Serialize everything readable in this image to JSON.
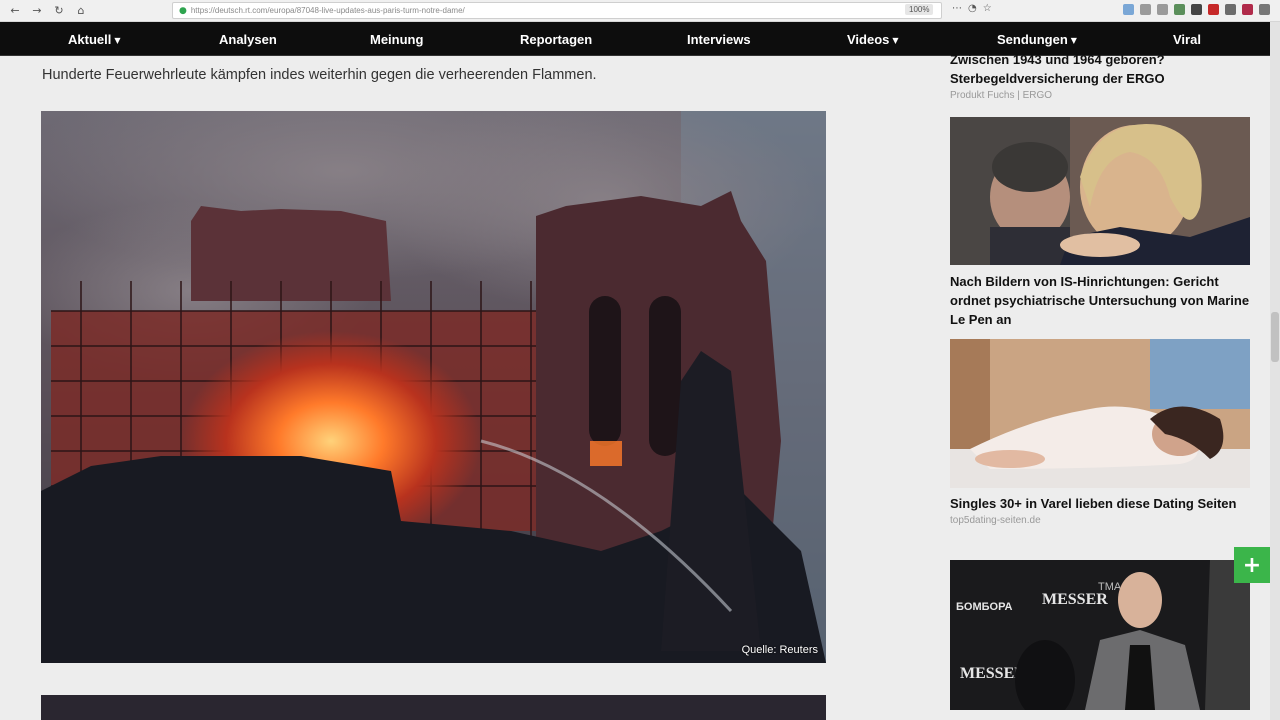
{
  "browser": {
    "url": "https://deutsch.rt.com/europa/87048-live-updates-aus-paris-turm-notre-dame/",
    "zoom": "100%",
    "icons": [
      "back-icon",
      "forward-icon",
      "reload-icon",
      "home-icon",
      "lock-icon",
      "reader-icon",
      "pocket-icon",
      "bookmark-star-icon"
    ]
  },
  "site_nav": {
    "items": [
      {
        "label": "Aktuell",
        "dropdown": true
      },
      {
        "label": "Analysen",
        "dropdown": false
      },
      {
        "label": "Meinung",
        "dropdown": false
      },
      {
        "label": "Reportagen",
        "dropdown": false
      },
      {
        "label": "Interviews",
        "dropdown": false
      },
      {
        "label": "Videos",
        "dropdown": true
      },
      {
        "label": "Sendungen",
        "dropdown": true
      },
      {
        "label": "Viral",
        "dropdown": false
      }
    ]
  },
  "article": {
    "lead": "Hunderte Feuerwehrleute kämpfen indes weiterhin gegen die verheerenden Flammen.",
    "photo_credit": "Quelle: Reuters"
  },
  "sidebar": {
    "items": [
      {
        "title": "Zwischen 1943 und 1964 geboren? Sterbegeldversicherung der ERGO",
        "source": "Produkt Fuchs | ERGO"
      },
      {
        "title": "Nach Bildern von IS-Hinrichtungen: Gericht ordnet psychiatrische Untersuchung von Marine Le Pen an",
        "source": ""
      },
      {
        "title": "Singles 30+ in Varel lieben diese Dating Seiten",
        "source": "top5dating-seiten.de"
      }
    ],
    "thumb4_texts": [
      "БОМБОРА",
      "MESSER",
      "MESSER",
      "TMA"
    ]
  },
  "colors": {
    "nav_bg": "#0d0d0d",
    "accent_green": "#3bb54a"
  },
  "floating": {
    "plus_label": "+"
  }
}
